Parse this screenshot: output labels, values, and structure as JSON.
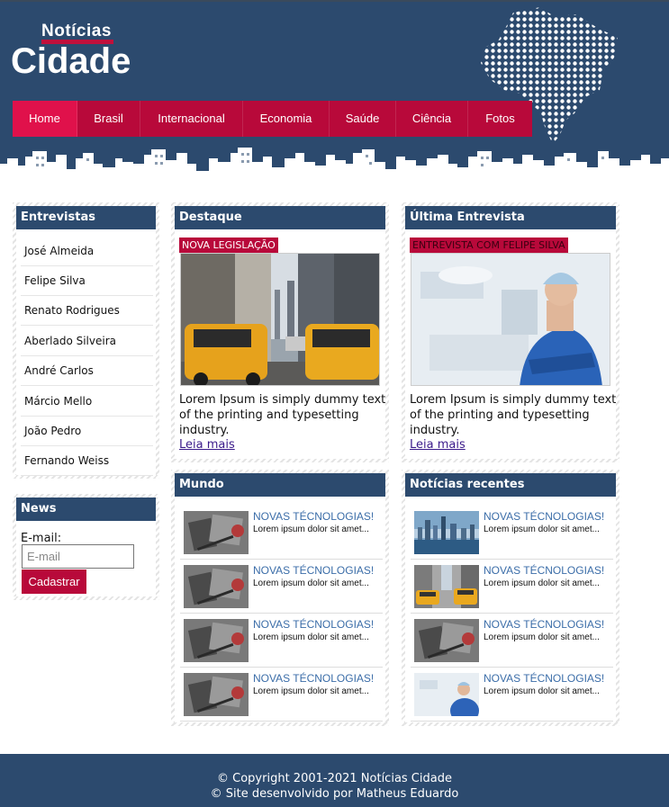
{
  "logo": {
    "small": "Notícias",
    "big": "Cidade"
  },
  "nav": [
    {
      "label": "Home",
      "active": true
    },
    {
      "label": "Brasil",
      "active": false
    },
    {
      "label": "Internacional",
      "active": false
    },
    {
      "label": "Economia",
      "active": false
    },
    {
      "label": "Saúde",
      "active": false
    },
    {
      "label": "Ciência",
      "active": false
    },
    {
      "label": "Fotos",
      "active": false
    }
  ],
  "entrevistas": {
    "title": "Entrevistas",
    "items": [
      "José Almeida",
      "Felipe Silva",
      "Renato Rodrigues",
      "Aberlado Silveira",
      "André Carlos",
      "Márcio Mello",
      "João Pedro",
      "Fernando Weiss"
    ]
  },
  "news": {
    "title": "News",
    "email_label": "E-mail:",
    "email_placeholder": "E-mail",
    "button": "Cadastrar"
  },
  "destaque": {
    "title": "Destaque",
    "tag": "NOVA LEGISLAÇÃO",
    "text": "Lorem Ipsum is simply dummy text of the printing and typesetting industry.",
    "link": "Leia mais"
  },
  "ultima": {
    "title": "Última Entrevista",
    "tag": "ENTREVISTA COM FELIPE SILVA",
    "text": "Lorem Ipsum is simply dummy text of the printing and typesetting industry.",
    "link": "Leia mais"
  },
  "mundo": {
    "title": "Mundo",
    "items": [
      {
        "title": "NOVAS TÉCNOLOGIAS!",
        "text": "Lorem ipsum dolor sit amet...",
        "thumb": "notebook"
      },
      {
        "title": "NOVAS TÉCNOLOGIAS!",
        "text": "Lorem ipsum dolor sit amet...",
        "thumb": "notebook"
      },
      {
        "title": "NOVAS TÉCNOLOGIAS!",
        "text": "Lorem ipsum dolor sit amet...",
        "thumb": "notebook"
      },
      {
        "title": "NOVAS TÉCNOLOGIAS!",
        "text": "Lorem ipsum dolor sit amet...",
        "thumb": "notebook"
      }
    ]
  },
  "recentes": {
    "title": "Notícias recentes",
    "items": [
      {
        "title": "NOVAS TÉCNOLOGIAS!",
        "text": "Lorem ipsum dolor sit amet...",
        "thumb": "skyline"
      },
      {
        "title": "NOVAS TÉCNOLOGIAS!",
        "text": "Lorem ipsum dolor sit amet...",
        "thumb": "taxi"
      },
      {
        "title": "NOVAS TÉCNOLOGIAS!",
        "text": "Lorem ipsum dolor sit amet...",
        "thumb": "notebook"
      },
      {
        "title": "NOVAS TÉCNOLOGIAS!",
        "text": "Lorem ipsum dolor sit amet...",
        "thumb": "doctor"
      }
    ]
  },
  "footer": {
    "line1": "© Copyright 2001-2021 Notícias Cidade",
    "line2": "© Site desenvolvido por Matheus Eduardo"
  },
  "colors": {
    "header": "#2c4a6e",
    "accent": "#b8093a",
    "accent_active": "#e0114b",
    "link_title": "#3b6da8"
  }
}
